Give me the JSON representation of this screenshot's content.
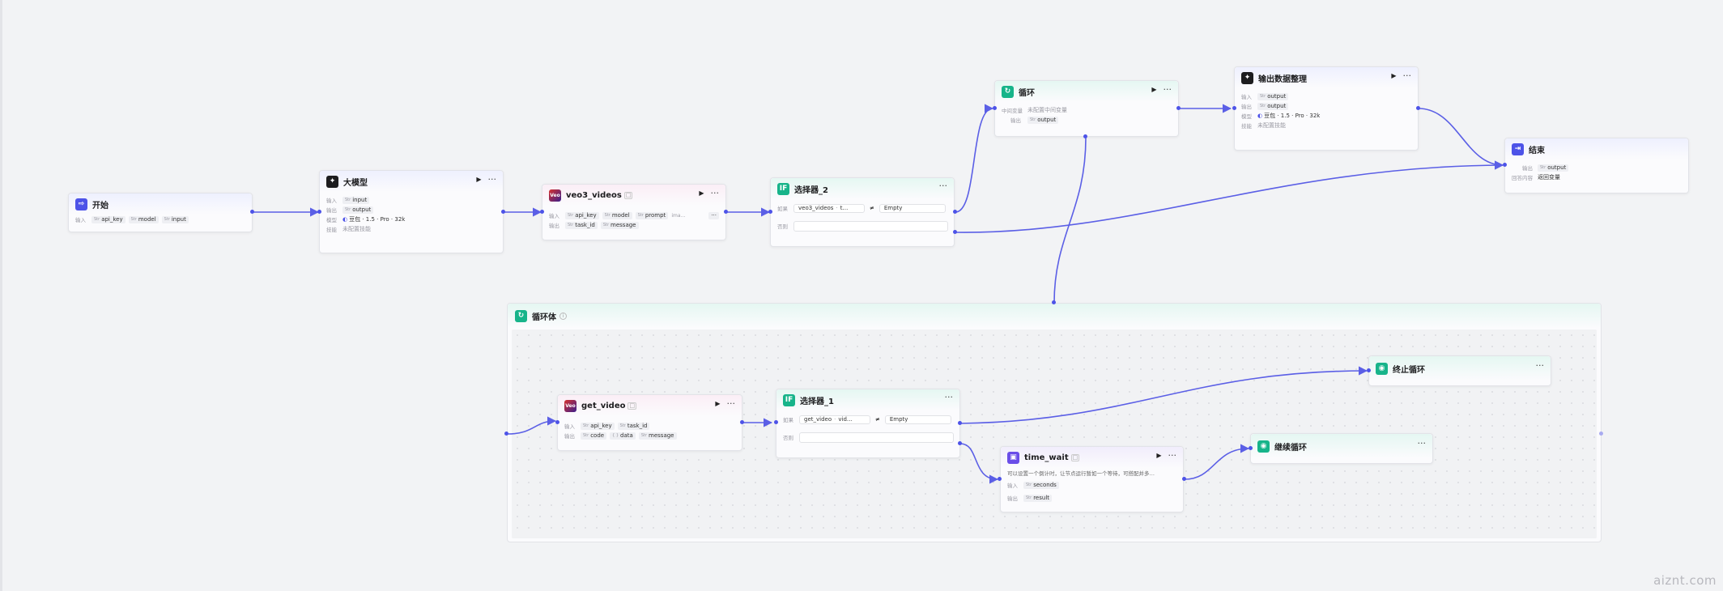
{
  "nodes": {
    "start": {
      "title": "开始",
      "input_label": "输入",
      "inputs": [
        "api_key",
        "model",
        "input"
      ]
    },
    "llm": {
      "title": "大模型",
      "input_label": "输入",
      "input": "input",
      "output_label": "输出",
      "output": "output",
      "model_label": "模型",
      "model": "豆包 · 1.5 · Pro · 32k",
      "skill_label": "技能",
      "skill": "未配置技能"
    },
    "veo3": {
      "title": "veo3_videos",
      "input_label": "输入",
      "inputs": [
        "api_key",
        "model",
        "prompt"
      ],
      "more_input": "ima…",
      "output_label": "输出",
      "outputs": [
        "task_id",
        "message"
      ]
    },
    "selector2": {
      "title": "选择器_2",
      "if_label": "如果",
      "left": "veo3_videos",
      "left_sub": "t…",
      "op": "≠",
      "right": "Empty",
      "else_label": "否则"
    },
    "loop": {
      "title": "循环",
      "var_label": "中间变量",
      "var_value": "未配置中间变量",
      "output_label": "输出",
      "output": "output"
    },
    "arrange": {
      "title": "输出数据整理",
      "input_label": "输入",
      "input": "output",
      "output_label": "输出",
      "output": "output",
      "model_label": "模型",
      "model": "豆包 · 1.5 · Pro · 32k",
      "skill_label": "技能",
      "skill": "未配置技能"
    },
    "end": {
      "title": "结束",
      "output_label": "输出",
      "output": "output",
      "type_label": "回答内容",
      "type_value": "返回变量"
    },
    "loopbody": {
      "title": "循环体"
    },
    "getvideo": {
      "title": "get_video",
      "input_label": "输入",
      "inputs": [
        "api_key",
        "task_id"
      ],
      "output_label": "输出",
      "outputs": [
        "code",
        "data",
        "message"
      ]
    },
    "selector1": {
      "title": "选择器_1",
      "if_label": "如果",
      "left": "get_video",
      "left_sub": "vid…",
      "op": "≠",
      "right": "Empty",
      "else_label": "否则"
    },
    "timewait": {
      "title": "time_wait",
      "desc": "可以设置一个倒计时，让节点运行暂如一个等待，可搭配并多…",
      "input_label": "输入",
      "input": "seconds",
      "output_label": "输出",
      "output": "result"
    },
    "stoploop": {
      "title": "终止循环"
    },
    "continueloop": {
      "title": "继续循环"
    }
  },
  "type_tags": {
    "str": "Str",
    "obj": "{ }"
  },
  "watermark": "aiznt.com",
  "colors": {
    "accent": "#4d53e8",
    "edge": "#5b5fe6",
    "green": "#17b48a"
  },
  "icons": {
    "start": "start-icon",
    "llm": "llm-icon",
    "veo": "veo-icon",
    "selector": "if-icon",
    "loop": "loop-icon",
    "end": "end-icon",
    "plugin": "plugin-icon"
  }
}
